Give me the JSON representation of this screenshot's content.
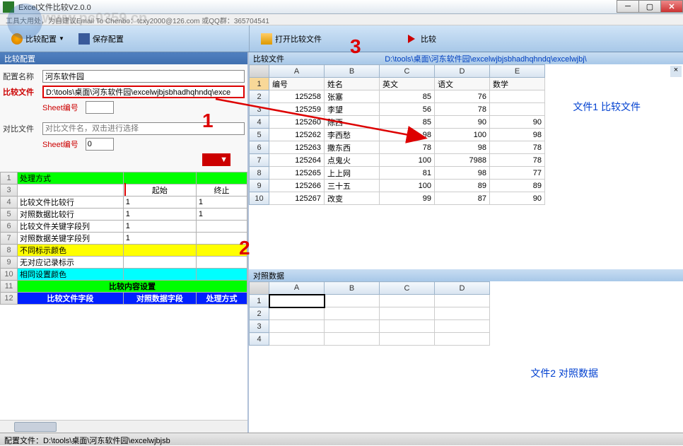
{
  "watermark": {
    "url": "www.pc0359.cn",
    "alt_text": "河东软件园"
  },
  "window": {
    "title": "Excel文件比较V2.0.0",
    "info": "工具大用处，为自建议Email To Chenbo：tcxy2000@126.com  或QQ群：365704541"
  },
  "toolbar": {
    "config": "比较配置",
    "save": "保存配置",
    "open": "打开比较文件",
    "compare": "比较"
  },
  "leftPanel": {
    "header": "比较配置",
    "configName": {
      "label": "配置名称",
      "value": "河东软件园"
    },
    "compareFile": {
      "label": "比较文件",
      "value": "D:\\tools\\桌面\\河东软件园\\excelwjbjsbhadhqhndq\\exce"
    },
    "contrastFile": {
      "label": "对比文件",
      "placeholder": "对比文件名，双击进行选择"
    },
    "sheetNum": {
      "label": "Sheet编号",
      "value1": "",
      "value2": "0"
    },
    "grid": {
      "headers": [
        "起始",
        "终止"
      ],
      "rows": [
        {
          "num": "1",
          "label": "处理方式",
          "c1": "",
          "c2": "",
          "cls": "row-green"
        },
        {
          "num": "3",
          "label": "",
          "c1": "起始",
          "c2": "终止",
          "cls": "header-row"
        },
        {
          "num": "4",
          "label": "比较文件比较行",
          "c1": "1",
          "c2": "1",
          "cls": ""
        },
        {
          "num": "5",
          "label": "对照数据比较行",
          "c1": "1",
          "c2": "1",
          "cls": ""
        },
        {
          "num": "6",
          "label": "比较文件关键字段列",
          "c1": "1",
          "c2": "",
          "cls": ""
        },
        {
          "num": "7",
          "label": "对照数据关键字段列",
          "c1": "1",
          "c2": "",
          "cls": ""
        },
        {
          "num": "8",
          "label": "不同标示颜色",
          "c1": "",
          "c2": "",
          "cls": "row-yellow"
        },
        {
          "num": "9",
          "label": "无对应记录标示",
          "c1": "",
          "c2": "",
          "cls": ""
        },
        {
          "num": "10",
          "label": "相同设置颜色",
          "c1": "",
          "c2": "",
          "cls": "row-cyan"
        },
        {
          "num": "11",
          "label": "比较内容设置",
          "c1": "",
          "c2": "",
          "cls": "row-green",
          "colspan": true
        },
        {
          "num": "12",
          "label": "比较文件字段",
          "c1": "对照数据字段",
          "c2": "处理方式",
          "cls": "row-blue"
        }
      ]
    }
  },
  "rightPanel": {
    "compareFile": {
      "label": "比较文件",
      "path": "D:\\tools\\桌面\\河东软件园\\excelwjbjsbhadhqhndq\\excelwjbj\\",
      "overlay": "文件1 比较文件",
      "cols": [
        "A",
        "B",
        "C",
        "D",
        "E"
      ],
      "headers": [
        "编号",
        "姓名",
        "英文",
        "语文",
        "数学"
      ],
      "rows": [
        {
          "n": "2",
          "d": [
            "125258",
            "张塞",
            "85",
            "76",
            ""
          ]
        },
        {
          "n": "3",
          "d": [
            "125259",
            "李望",
            "56",
            "78",
            ""
          ]
        },
        {
          "n": "4",
          "d": [
            "125260",
            "陈西",
            "85",
            "90",
            "90"
          ]
        },
        {
          "n": "5",
          "d": [
            "125262",
            "李西愁",
            "98",
            "100",
            "98"
          ]
        },
        {
          "n": "6",
          "d": [
            "125263",
            "撒东西",
            "78",
            "98",
            "78"
          ]
        },
        {
          "n": "7",
          "d": [
            "125264",
            "点鬼火",
            "100",
            "7988",
            "78"
          ]
        },
        {
          "n": "8",
          "d": [
            "125265",
            "上上网",
            "81",
            "98",
            "77"
          ]
        },
        {
          "n": "9",
          "d": [
            "125266",
            "三十五",
            "100",
            "89",
            "89"
          ]
        },
        {
          "n": "10",
          "d": [
            "125267",
            "改变",
            "99",
            "87",
            "90"
          ]
        }
      ]
    },
    "contrastData": {
      "label": "对照数据",
      "overlay": "文件2 对照数据",
      "cols": [
        "A",
        "B",
        "C",
        "D"
      ],
      "rows": [
        "1",
        "2",
        "3",
        "4"
      ]
    }
  },
  "annotations": {
    "n1": "1",
    "n2": "2",
    "n3": "3"
  },
  "statusbar": "配置文件：D:\\tools\\桌面\\河东软件园\\excelwjbjsb"
}
